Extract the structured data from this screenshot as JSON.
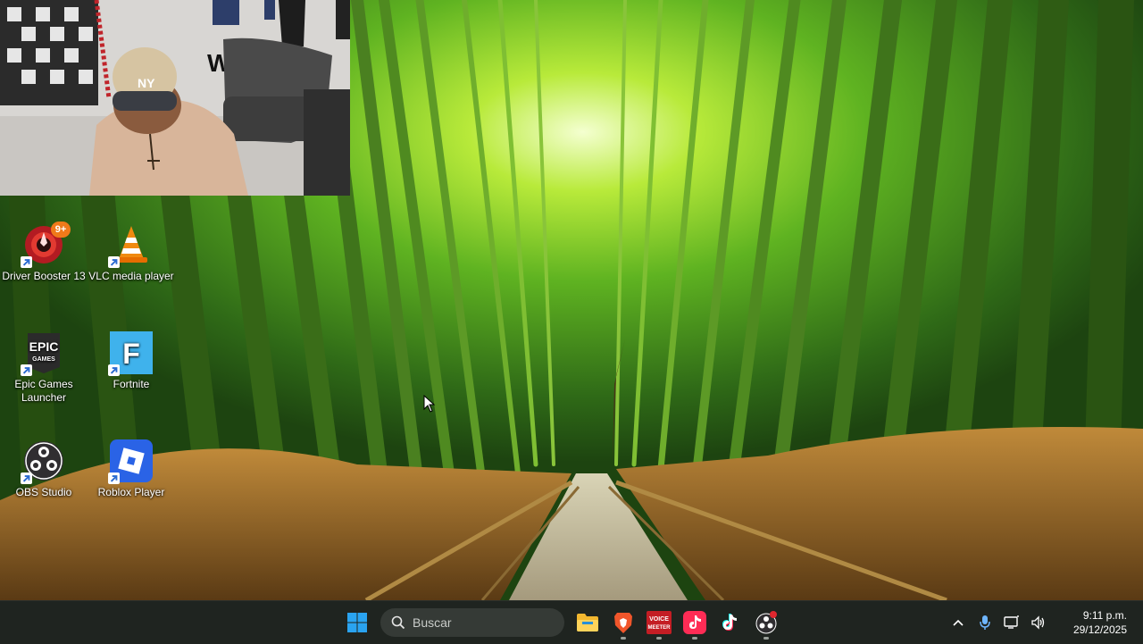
{
  "desktop": {
    "icons": [
      {
        "label": "Driver Booster 13",
        "icon": "driver-booster-icon",
        "badge": "9+"
      },
      {
        "label": "VLC media player",
        "icon": "vlc-icon"
      },
      {
        "label": "Epic Games Launcher",
        "icon": "epic-games-icon",
        "glyph_top": "EPIC",
        "glyph_bottom": "GAMES"
      },
      {
        "label": "Fortnite",
        "icon": "fortnite-icon",
        "glyph": "F"
      },
      {
        "label": "OBS Studio",
        "icon": "obs-icon"
      },
      {
        "label": "Roblox Player",
        "icon": "roblox-icon"
      }
    ]
  },
  "taskbar": {
    "search_placeholder": "Buscar",
    "pinned": [
      {
        "name": "file-explorer",
        "running": false
      },
      {
        "name": "brave",
        "running": true
      },
      {
        "name": "voicemeeter",
        "running": true
      },
      {
        "name": "tiktok-studio",
        "running": true
      },
      {
        "name": "tiktok",
        "running": false
      },
      {
        "name": "obs",
        "running": true
      }
    ],
    "voicemeeter_line1": "VOICE",
    "voicemeeter_line2": "MEETER",
    "clock_time": "9:11 p.m.",
    "clock_date": "29/12/2025"
  },
  "colors": {
    "taskbar_bg": "#1f2420",
    "windows_blue": "#2aa3f0",
    "accent_red": "#e0272f"
  }
}
